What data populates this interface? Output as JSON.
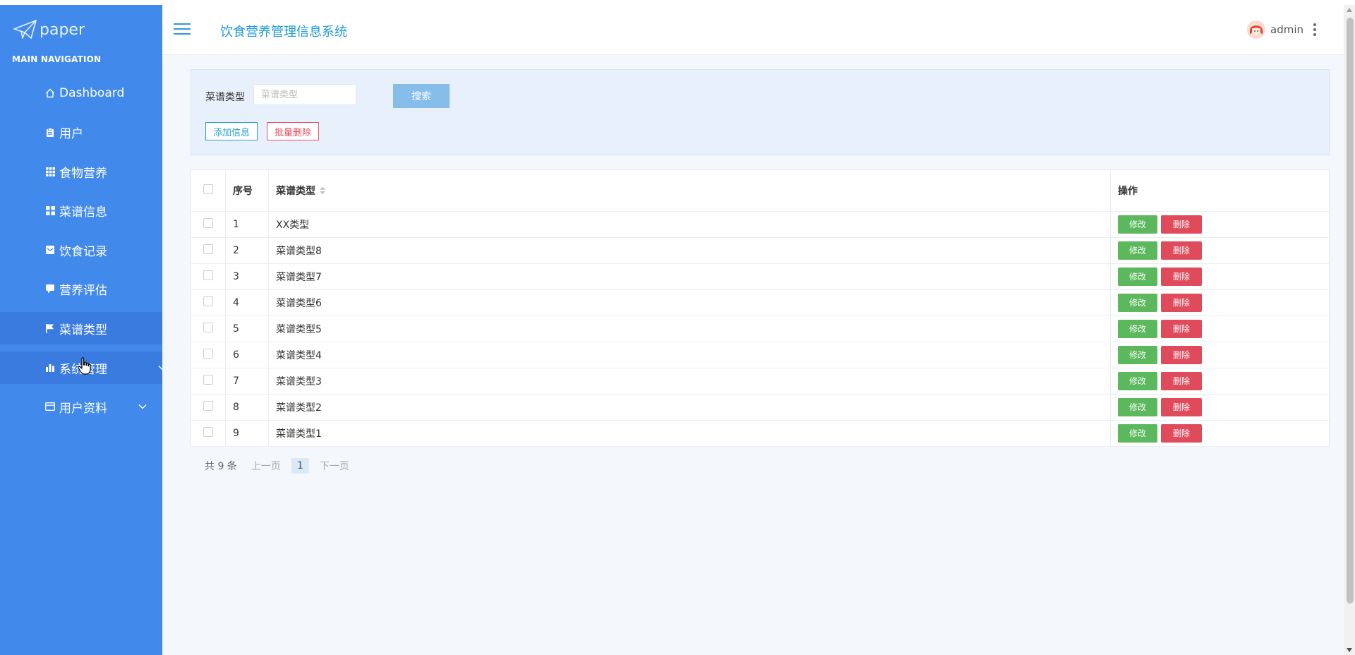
{
  "brand": {
    "logo_text": "paper"
  },
  "sidebar": {
    "nav_title": "MAIN NAVIGATION",
    "items": [
      {
        "label": "Dashboard",
        "icon": "home-icon"
      },
      {
        "label": "用户",
        "icon": "clipboard-icon"
      },
      {
        "label": "食物营养",
        "icon": "grid-icon"
      },
      {
        "label": "菜谱信息",
        "icon": "apps-icon"
      },
      {
        "label": "饮食记录",
        "icon": "mail-icon"
      },
      {
        "label": "营养评估",
        "icon": "chat-icon"
      },
      {
        "label": "菜谱类型",
        "icon": "flag-icon",
        "state": "active"
      },
      {
        "label": "系统管理",
        "icon": "bar-chart-icon",
        "state": "hover",
        "has_submenu": true
      },
      {
        "label": "用户资料",
        "icon": "card-icon",
        "has_submenu": true
      }
    ]
  },
  "header": {
    "title": "饮食营养管理信息系统",
    "user": "admin"
  },
  "search": {
    "label": "菜谱类型",
    "placeholder": "菜谱类型",
    "value": "",
    "button": "搜索"
  },
  "actions": {
    "add": "添加信息",
    "batch_delete": "批量删除"
  },
  "table": {
    "headers": {
      "index": "序号",
      "type": "菜谱类型",
      "ops": "操作"
    },
    "edit_label": "修改",
    "delete_label": "删除",
    "rows": [
      {
        "index": "1",
        "type": "XX类型"
      },
      {
        "index": "2",
        "type": "菜谱类型8"
      },
      {
        "index": "3",
        "type": "菜谱类型7"
      },
      {
        "index": "4",
        "type": "菜谱类型6"
      },
      {
        "index": "5",
        "type": "菜谱类型5"
      },
      {
        "index": "6",
        "type": "菜谱类型4"
      },
      {
        "index": "7",
        "type": "菜谱类型3"
      },
      {
        "index": "8",
        "type": "菜谱类型2"
      },
      {
        "index": "9",
        "type": "菜谱类型1"
      }
    ]
  },
  "pagination": {
    "total": "共 9 条",
    "prev": "上一页",
    "current": "1",
    "next": "下一页"
  },
  "colors": {
    "sidebar_bg": "#418aec",
    "sidebar_active": "#3a7be0",
    "title_blue": "#1e9ad6",
    "edit_green": "#5cb85c",
    "delete_red": "#e04b5c"
  }
}
